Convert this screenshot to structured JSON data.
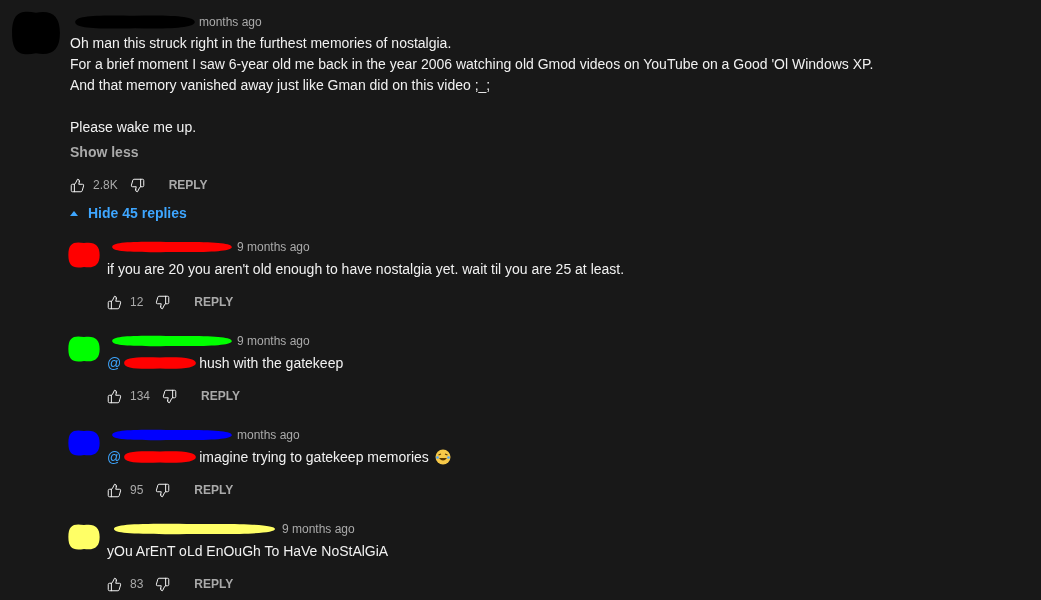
{
  "comment": {
    "color": "#000000",
    "time": "months ago",
    "paragraphs": [
      [
        "Oh man this struck right in the furthest memories of nostalgia.",
        "For a brief moment I saw 6-year old me back in the year 2006 watching old Gmod videos on YouTube on a Good 'Ol Windows XP.",
        "And that memory vanished away just like Gman did on this video ;_;"
      ],
      [
        "Please wake me up."
      ]
    ],
    "show_less": "Show less",
    "likes": "2.8K",
    "reply_label": "REPLY"
  },
  "replies_toggle": {
    "label": "Hide 45 replies",
    "expanded": true
  },
  "replies": [
    {
      "color": "#ff0000",
      "time": "9 months ago",
      "text": "if you are 20 you aren't old enough to have nostalgia yet. wait til you are 25 at least.",
      "emoji": false,
      "likes": "12",
      "reply_label": "REPLY"
    },
    {
      "color": "#00ff00",
      "time": "9 months ago",
      "mention": {
        "at": "@",
        "color": "#ff0000"
      },
      "text": "hush with the gatekeep",
      "emoji": false,
      "likes": "134",
      "reply_label": "REPLY"
    },
    {
      "color": "#0000ff",
      "time": "months ago",
      "mention": {
        "at": "@",
        "color": "#ff0000"
      },
      "text": "imagine trying to gatekeep memories",
      "emoji": true,
      "likes": "95",
      "reply_label": "REPLY"
    },
    {
      "color": "#ffff66",
      "time": "9 months ago",
      "text": "yOu ArEnT oLd EnOuGh To HaVe NoStAlGiA",
      "emoji": false,
      "likes": "83",
      "reply_label": "REPLY"
    }
  ]
}
